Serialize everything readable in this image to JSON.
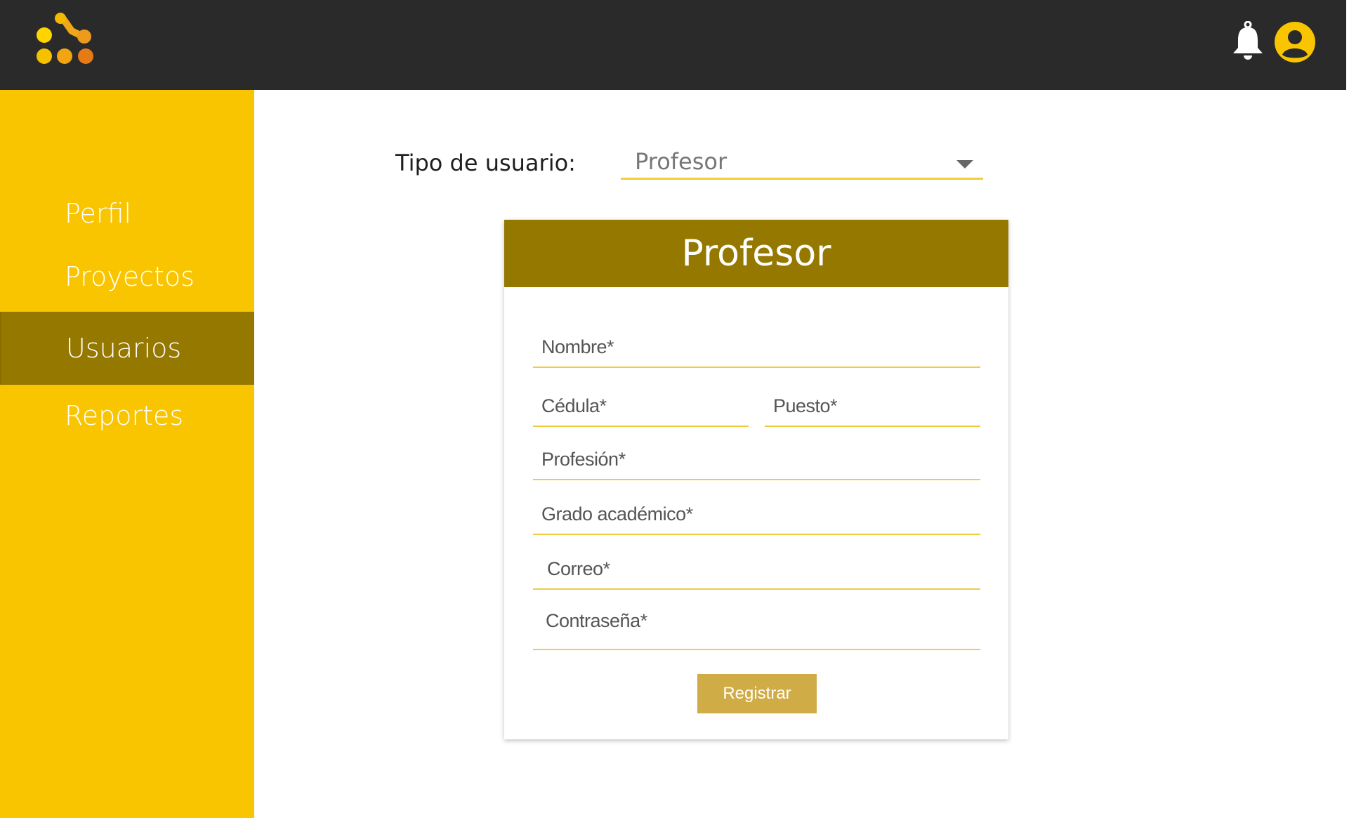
{
  "header": {
    "logo_icon": "app-logo-dots",
    "notifications_icon": "bell-icon",
    "account_icon": "user-circle-icon"
  },
  "sidebar": {
    "items": [
      {
        "label": "Perfil"
      },
      {
        "label": "Proyectos"
      },
      {
        "label": "Usuarios"
      },
      {
        "label": "Reportes"
      }
    ],
    "active_item": "Usuarios"
  },
  "main": {
    "user_type_label": "Tipo de usuario:",
    "user_type_value": "Profesor"
  },
  "form": {
    "title": "Profesor",
    "fields": {
      "nombre": "Nombre*",
      "cedula": "Cédula*",
      "puesto": "Puesto*",
      "profesion": "Profesión*",
      "grado": "Grado académico*",
      "correo": "Correo*",
      "contrasena": "Contraseña*"
    },
    "submit_label": "Registrar"
  },
  "colors": {
    "header_bg": "#2a2a2a",
    "sidebar_bg": "#f8c500",
    "active_bg": "#957800",
    "field_underline": "#f0cc3e",
    "button_bg": "#cfac46"
  }
}
